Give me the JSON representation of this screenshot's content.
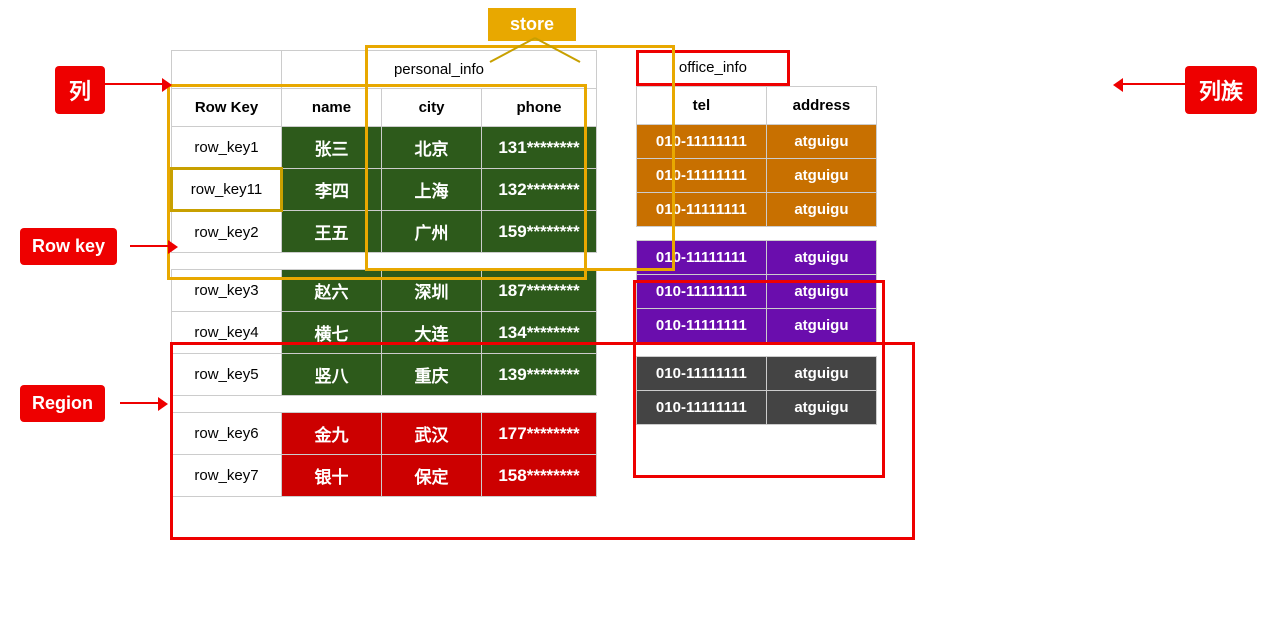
{
  "labels": {
    "lie": "列",
    "rowkey": "Row key",
    "region": "Region",
    "liezhu": "列族",
    "store": "store",
    "personal_info": "personal_info",
    "office_info": "office_info"
  },
  "columns": {
    "rowkey": "Row Key",
    "name": "name",
    "city": "city",
    "phone": "phone",
    "tel": "tel",
    "address": "address"
  },
  "rows": [
    {
      "key": "row_key1",
      "name": "张三",
      "city": "北京",
      "phone": "131********",
      "tel": "010-11111111",
      "address": "atguigu",
      "group": "green"
    },
    {
      "key": "row_key11",
      "name": "李四",
      "city": "上海",
      "phone": "132********",
      "tel": "010-11111111",
      "address": "atguigu",
      "group": "green"
    },
    {
      "key": "row_key2",
      "name": "王五",
      "city": "广州",
      "phone": "159********",
      "tel": "010-11111111",
      "address": "atguigu",
      "group": "green"
    },
    {
      "key": "row_key3",
      "name": "赵六",
      "city": "深圳",
      "phone": "187********",
      "tel": "010-11111111",
      "address": "atguigu",
      "group": "purple"
    },
    {
      "key": "row_key4",
      "name": "横七",
      "city": "大连",
      "phone": "134********",
      "tel": "010-11111111",
      "address": "atguigu",
      "group": "purple"
    },
    {
      "key": "row_key5",
      "name": "竖八",
      "city": "重庆",
      "phone": "139********",
      "tel": "010-11111111",
      "address": "atguigu",
      "group": "purple"
    },
    {
      "key": "row_key6",
      "name": "金九",
      "city": "武汉",
      "phone": "177********",
      "tel": "010-11111111",
      "address": "atguigu",
      "group": "dark"
    },
    {
      "key": "row_key7",
      "name": "银十",
      "city": "保定",
      "phone": "158********",
      "tel": "010-11111111",
      "address": "atguigu",
      "group": "dark"
    }
  ]
}
